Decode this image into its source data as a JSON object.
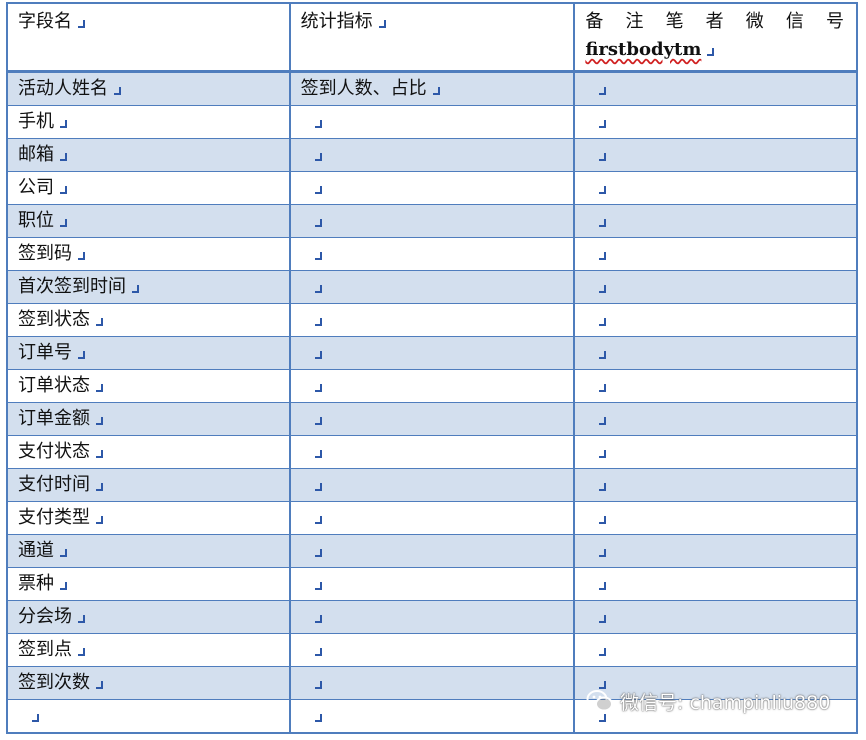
{
  "header": {
    "field_label": "字段名",
    "metric_label": "统计指标",
    "note_chars": [
      "备",
      "注",
      "笔",
      "者",
      "微",
      "信",
      "号"
    ],
    "wechat_id": "firstbodytm"
  },
  "rows": [
    {
      "field": "活动人姓名",
      "metric": "签到人数、占比",
      "note": ""
    },
    {
      "field": "手机",
      "metric": "",
      "note": ""
    },
    {
      "field": "邮箱",
      "metric": "",
      "note": ""
    },
    {
      "field": "公司",
      "metric": "",
      "note": ""
    },
    {
      "field": "职位",
      "metric": "",
      "note": ""
    },
    {
      "field": "签到码",
      "metric": "",
      "note": ""
    },
    {
      "field": "首次签到时间",
      "metric": "",
      "note": ""
    },
    {
      "field": "签到状态",
      "metric": "",
      "note": ""
    },
    {
      "field": "订单号",
      "metric": "",
      "note": ""
    },
    {
      "field": "订单状态",
      "metric": "",
      "note": ""
    },
    {
      "field": "订单金额",
      "metric": "",
      "note": ""
    },
    {
      "field": "支付状态",
      "metric": "",
      "note": ""
    },
    {
      "field": "支付时间",
      "metric": "",
      "note": ""
    },
    {
      "field": "支付类型",
      "metric": "",
      "note": ""
    },
    {
      "field": "通道",
      "metric": "",
      "note": ""
    },
    {
      "field": "票种",
      "metric": "",
      "note": ""
    },
    {
      "field": "分会场",
      "metric": "",
      "note": ""
    },
    {
      "field": "签到点",
      "metric": "",
      "note": ""
    },
    {
      "field": "签到次数",
      "metric": "",
      "note": ""
    },
    {
      "field": "",
      "metric": "",
      "note": ""
    }
  ],
  "watermark": {
    "text": "微信号: champinliu880",
    "icon": "wechat-icon"
  },
  "colors": {
    "border": "#4f7dbd",
    "row_shade": "#d3dfee",
    "paragraph_mark": "#2d58a8",
    "spellcheck_underline": "#d02020"
  }
}
